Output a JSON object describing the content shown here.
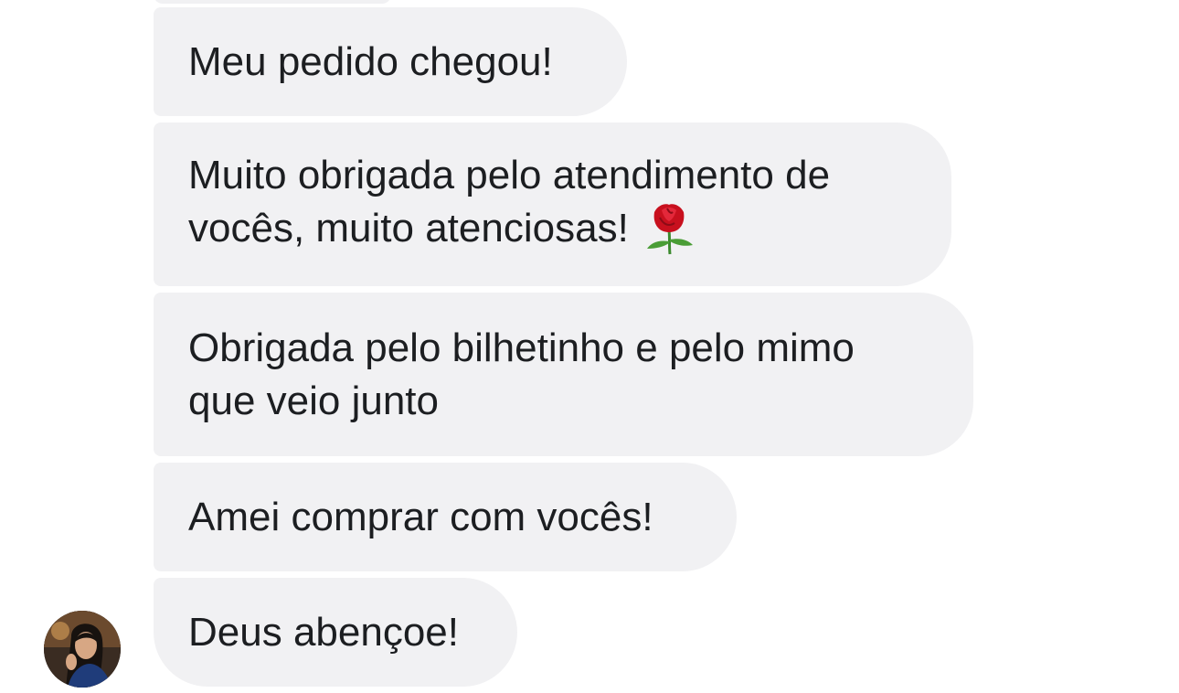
{
  "messages": [
    {
      "text": "Meu pedido chegou!"
    },
    {
      "line1": "Muito obrigada pelo atendimento de",
      "line2": "vocês, muito atenciosas!",
      "emoji": "rose-emoji"
    },
    {
      "line1": "Obrigada pelo bilhetinho e pelo mimo",
      "line2": "que veio junto"
    },
    {
      "text": "Amei comprar com vocês!"
    },
    {
      "text": "Deus abençoe!"
    }
  ],
  "colors": {
    "bubble": "#f1f1f3",
    "text": "#1c1e21",
    "background": "#ffffff"
  },
  "sender": {
    "avatar": "user-avatar-photo"
  }
}
